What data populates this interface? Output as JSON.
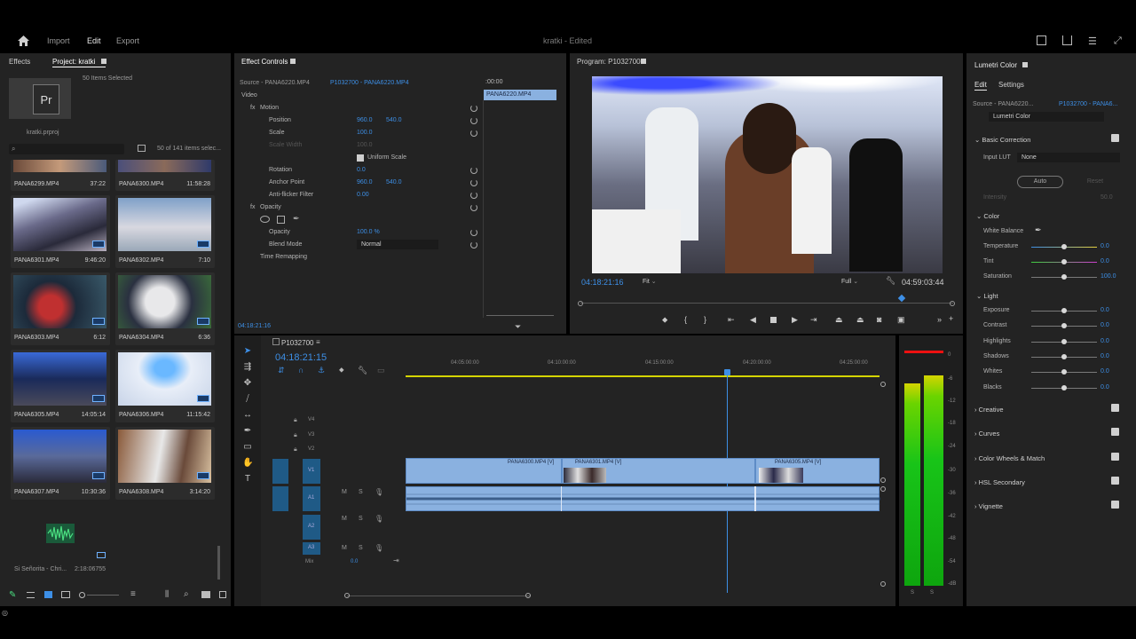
{
  "topbar": {
    "import": "Import",
    "edit": "Edit",
    "export": "Export",
    "project_name": "kratki",
    "edited": " - Edited"
  },
  "project": {
    "tab_effects": "Effects",
    "tab_project": "Project: kratki",
    "selected": "50 Items Selected",
    "file": "kratki.prproj",
    "count": "50 of 141 items selec...",
    "items": [
      {
        "name": "PANA6299.MP4",
        "dur": "37:22"
      },
      {
        "name": "PANA6300.MP4",
        "dur": "11:58:28"
      },
      {
        "name": "PANA6301.MP4",
        "dur": "9:46:20"
      },
      {
        "name": "PANA6302.MP4",
        "dur": "7:10"
      },
      {
        "name": "PANA6303.MP4",
        "dur": "6:12"
      },
      {
        "name": "PANA6304.MP4",
        "dur": "6:36"
      },
      {
        "name": "PANA6305.MP4",
        "dur": "14:05:14"
      },
      {
        "name": "PANA6306.MP4",
        "dur": "11:15:42"
      },
      {
        "name": "PANA6307.MP4",
        "dur": "10:30:36"
      },
      {
        "name": "PANA6308.MP4",
        "dur": "3:14:20"
      }
    ],
    "audio_item": {
      "name": "Si Señorita - Chri...",
      "dur": "2:18:06755"
    }
  },
  "effect_controls": {
    "tab": "Effect Controls",
    "source": "Source - PANA6220.MP4",
    "seq": "P1032700 - PANA6220.MP4",
    "clip_label": "PANA6220.MP4",
    "time_ruler": ":00:00",
    "video": "Video",
    "motion": "Motion",
    "position": "Position",
    "pos_x": "960.0",
    "pos_y": "540.0",
    "scale": "Scale",
    "scale_val": "100.0",
    "scale_width": "Scale Width",
    "scale_width_val": "100.0",
    "uniform": "Uniform Scale",
    "rotation": "Rotation",
    "rotation_val": "0.0",
    "anchor": "Anchor Point",
    "anchor_x": "960.0",
    "anchor_y": "540.0",
    "antiflicker": "Anti-flicker Filter",
    "antiflicker_val": "0.00",
    "opacity_group": "Opacity",
    "opacity": "Opacity",
    "opacity_val": "100.0 %",
    "blend": "Blend Mode",
    "blend_val": "Normal",
    "time_remap": "Time Remapping",
    "timecode": "04:18:21:16"
  },
  "program": {
    "tab": "Program: P1032700",
    "timecode": "04:18:21:16",
    "fit": "Fit",
    "full": "Full",
    "duration": "04:59:03:44"
  },
  "timeline": {
    "tab": "P1032700",
    "timecode": "04:18:21:15",
    "ruler": [
      "04:05:00:00",
      "04:10:00:00",
      "04:15:00:00",
      "04:20:00:00",
      "04:25:00:00"
    ],
    "tracks_v": [
      "V4",
      "V3",
      "V2",
      "V1"
    ],
    "tracks_a": [
      "A1",
      "A2",
      "A3"
    ],
    "mix": "Mix",
    "mix_val": "0.0",
    "clips": [
      "PANA6300.MP4 [V]",
      "PANA6301.MP4 [V]",
      "PANA6305.MP4 [V]"
    ],
    "meter_scale": [
      "0",
      "-6",
      "-12",
      "-18",
      "-24",
      "-30",
      "-36",
      "-42",
      "-48",
      "-54",
      "-dB"
    ],
    "meter_labels": [
      "S",
      "S"
    ]
  },
  "lumetri": {
    "tab": "Lumetri Color",
    "edit": "Edit",
    "settings": "Settings",
    "source": "Source - PANA6220...",
    "seq": "P1032700 - PANA6...",
    "effect": "Lumetri Color",
    "basic": "Basic Correction",
    "input_lut": "Input LUT",
    "lut_val": "None",
    "auto": "Auto",
    "reset": "Reset",
    "intensity": "Intensity",
    "intensity_val": "50.0",
    "color": "Color",
    "wb": "White Balance",
    "temperature": "Temperature",
    "tint": "Tint",
    "saturation": "Saturation",
    "temp_val": "0.0",
    "tint_val": "0.0",
    "sat_val": "100.0",
    "light": "Light",
    "exposure": "Exposure",
    "contrast": "Contrast",
    "highlights": "Highlights",
    "shadows": "Shadows",
    "whites": "Whites",
    "blacks": "Blacks",
    "zero": "0.0",
    "creative": "Creative",
    "curves": "Curves",
    "wheels": "Color Wheels & Match",
    "hsl": "HSL Secondary",
    "vignette": "Vignette"
  },
  "colors": {
    "accent": "#3d8fe6",
    "clip": "#8ab1e0",
    "panel": "#232323"
  }
}
